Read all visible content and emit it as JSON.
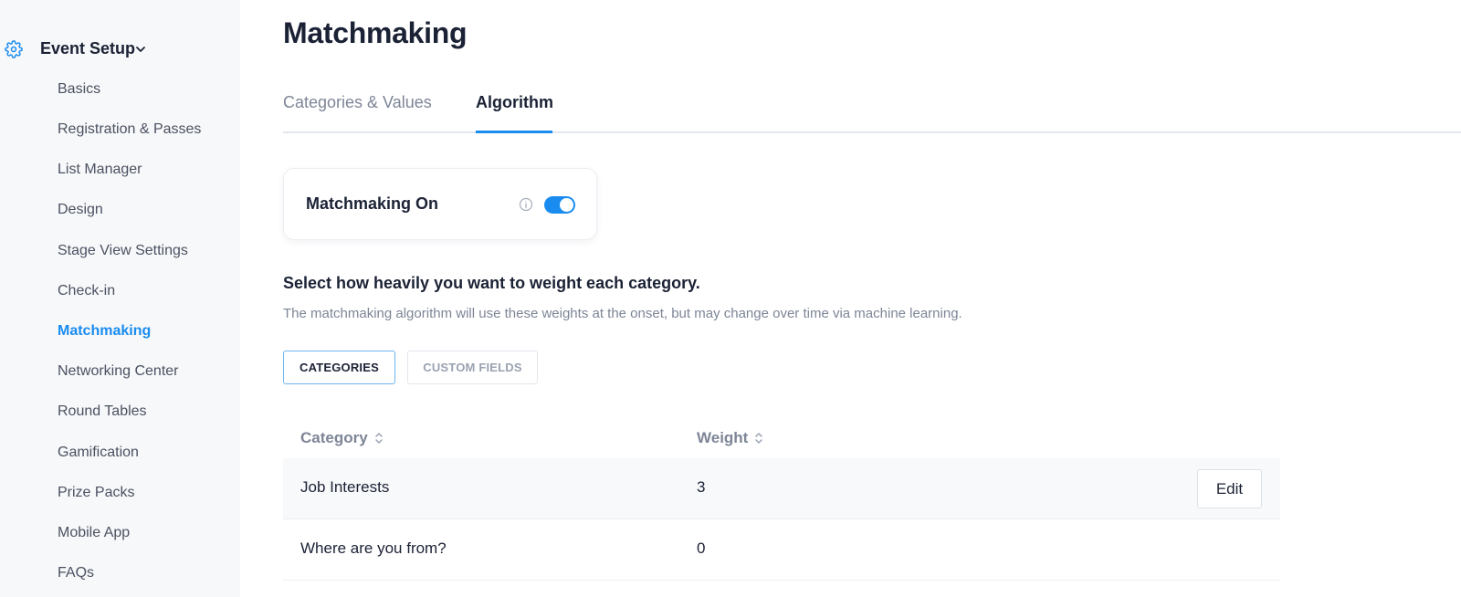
{
  "sidebar": {
    "section_title": "Event Setup",
    "items": [
      {
        "label": "Basics"
      },
      {
        "label": "Registration & Passes"
      },
      {
        "label": "List Manager"
      },
      {
        "label": "Design"
      },
      {
        "label": "Stage View Settings"
      },
      {
        "label": "Check-in"
      },
      {
        "label": "Matchmaking",
        "active": true
      },
      {
        "label": "Networking Center"
      },
      {
        "label": "Round Tables"
      },
      {
        "label": "Gamification"
      },
      {
        "label": "Prize Packs"
      },
      {
        "label": "Mobile App"
      },
      {
        "label": "FAQs"
      }
    ]
  },
  "main": {
    "title": "Matchmaking",
    "tabs": [
      {
        "label": "Categories & Values",
        "active": false
      },
      {
        "label": "Algorithm",
        "active": true
      }
    ],
    "toggle_card": {
      "label": "Matchmaking On",
      "enabled": true
    },
    "heading": "Select how heavily you want to weight each category.",
    "subtext": "The matchmaking algorithm will use these weights at the onset, but may change over time via machine learning.",
    "segments": [
      {
        "label": "CATEGORIES",
        "active": true
      },
      {
        "label": "CUSTOM FIELDS",
        "active": false
      }
    ],
    "table": {
      "columns": [
        "Category",
        "Weight"
      ],
      "rows": [
        {
          "category": "Job Interests",
          "weight": "3",
          "action": "Edit"
        },
        {
          "category": "Where are you from?",
          "weight": "0"
        }
      ]
    }
  },
  "colors": {
    "accent": "#1a8cf0",
    "text_primary": "#1b2235",
    "text_muted": "#7d8596",
    "sidebar_bg": "#f7f8fa"
  }
}
